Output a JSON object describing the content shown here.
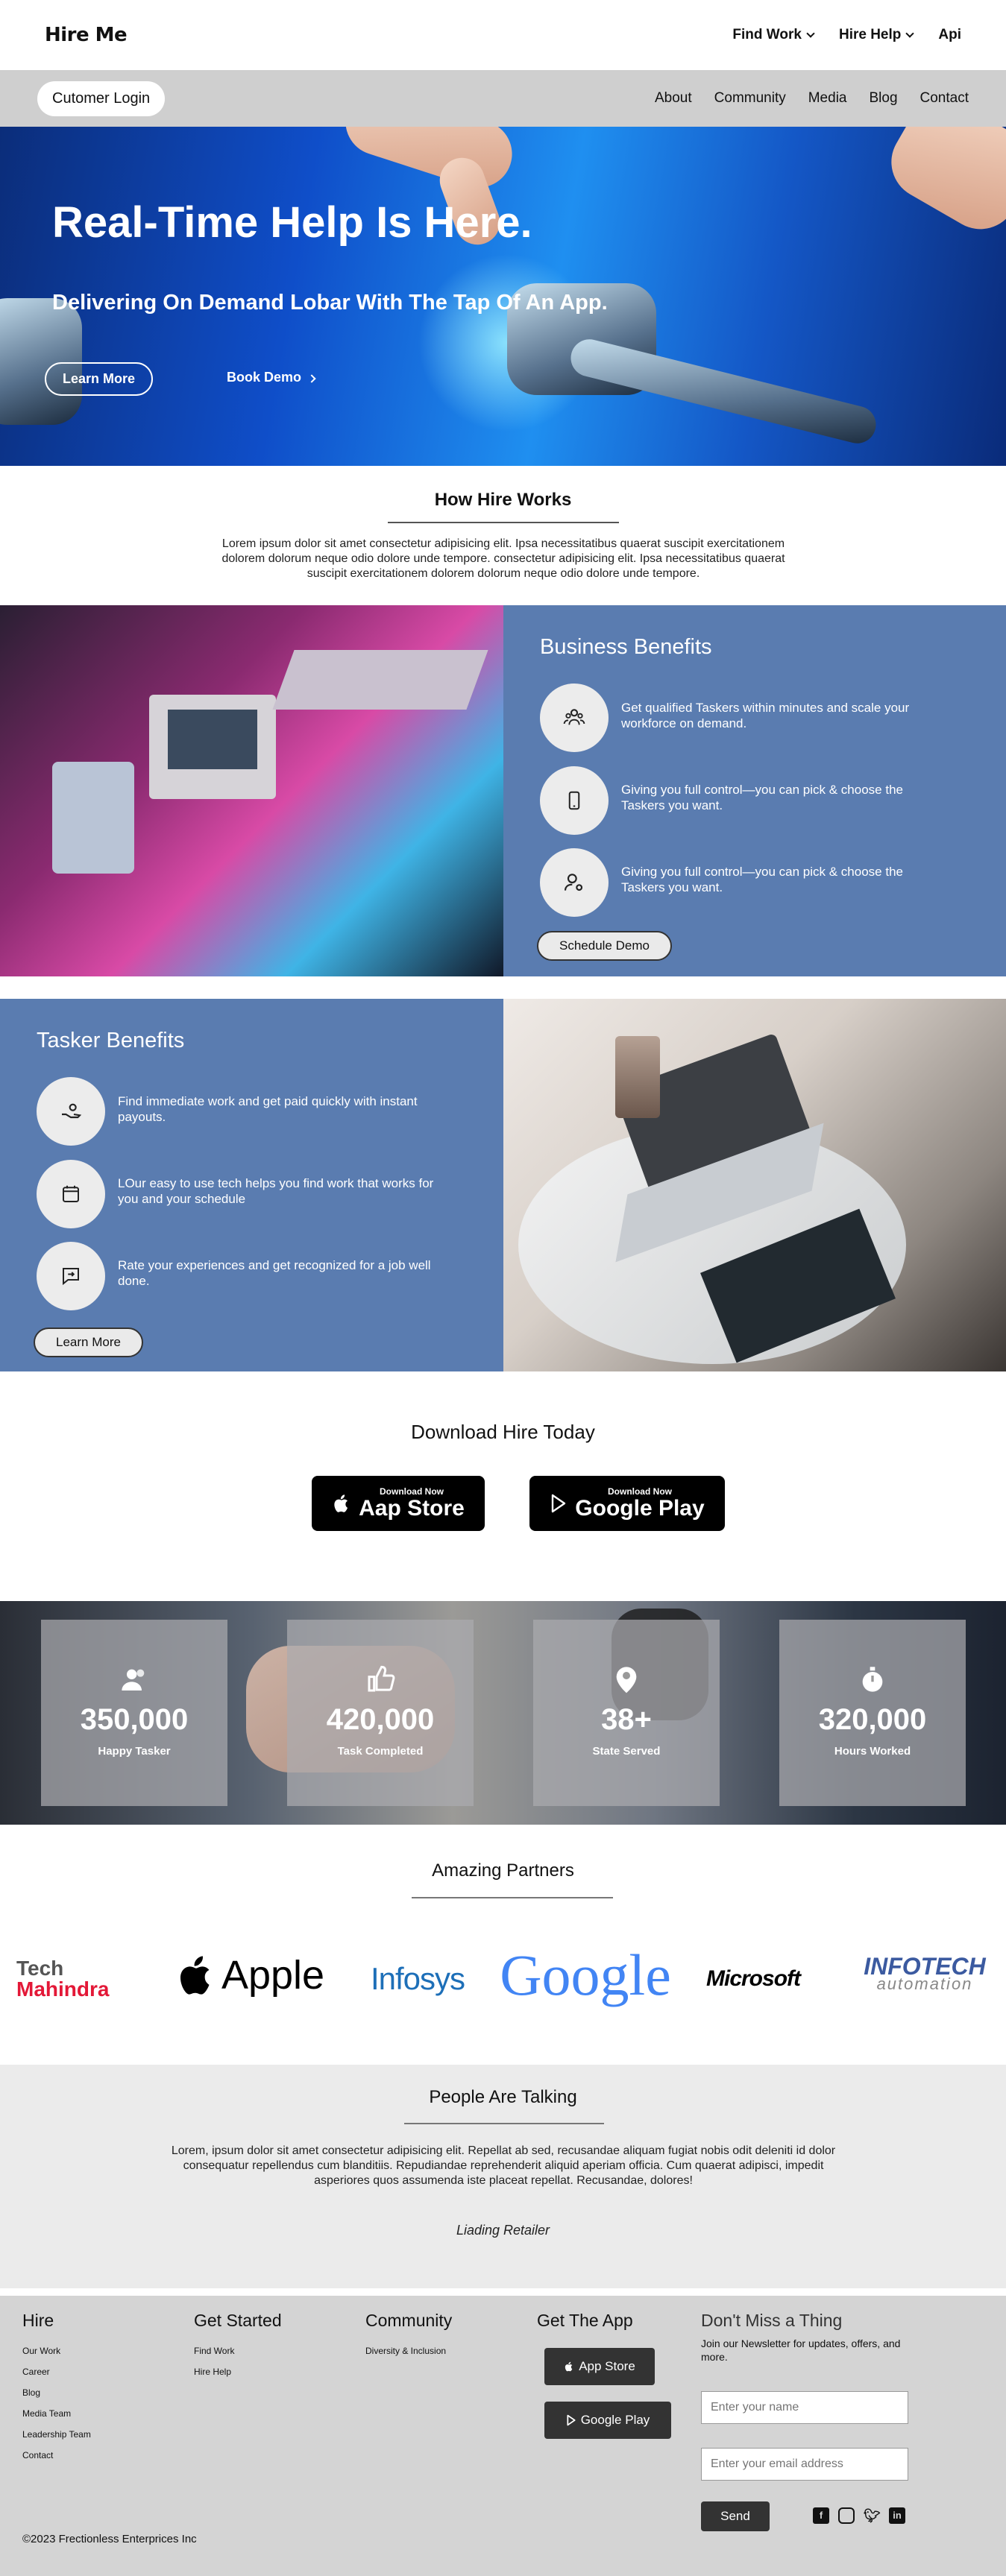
{
  "topnav": {
    "logo": "Hire Me",
    "find_work": "Find Work",
    "hire_help": "Hire Help",
    "api": "Api"
  },
  "subnav": {
    "login": "Cutomer Login",
    "links": [
      "About",
      "Community",
      "Media",
      "Blog",
      "Contact"
    ]
  },
  "hero": {
    "title": "Real-Time Help Is Here.",
    "subtitle": "Delivering On Demand Lobar With The Tap Of An App.",
    "learn_more": "Learn More",
    "book_demo": "Book Demo"
  },
  "how": {
    "title": "How Hire Works",
    "text": "Lorem ipsum dolor sit amet consectetur adipisicing elit. Ipsa necessitatibus quaerat suscipit exercitationem dolorem dolorum neque odio dolore unde tempore. consectetur adipisicing elit. Ipsa necessitatibus quaerat suscipit exercitationem dolorem dolorum neque odio dolore unde tempore."
  },
  "business": {
    "title": "Business Benefits",
    "items": [
      "Get qualified Taskers within minutes and scale your workforce on demand.",
      "Giving you full control—you can pick & choose the Taskers you want.",
      "Giving you full control—you can pick & choose the Taskers you want."
    ],
    "button": "Schedule Demo"
  },
  "tasker": {
    "title": "Tasker Benefits",
    "items": [
      "Find immediate work and get paid quickly with instant payouts.",
      "LOur easy to use tech helps you find work that works for you and your schedule",
      "Rate your experiences and get recognized for a job well done."
    ],
    "button": "Learn More"
  },
  "download": {
    "title": "Download Hire Today",
    "app_small": "Download Now",
    "app_big": "Aap Store",
    "play_small": "Download Now",
    "play_big": "Google Play"
  },
  "stats": [
    {
      "value": "350,000",
      "label": "Happy Tasker"
    },
    {
      "value": "420,000",
      "label": "Task Completed"
    },
    {
      "value": "38+",
      "label": "State Served"
    },
    {
      "value": "320,000",
      "label": "Hours Worked"
    }
  ],
  "partners": {
    "title": "Amazing Partners",
    "names": [
      "Tech",
      "Mahindra",
      "Apple",
      "Infosys",
      "Google",
      "Microsoft",
      "INFOTECH",
      "automation"
    ]
  },
  "talking": {
    "title": "People Are Talking",
    "text": "Lorem, ipsum dolor sit amet consectetur adipisicing elit. Repellat ab sed, recusandae aliquam fugiat nobis odit deleniti id dolor consequatur repellendus cum blanditiis. Repudiandae reprehenderit aliquid aperiam officia. Cum quaerat adipisci, impedit asperiores quos assumenda iste placeat repellat. Recusandae, dolores!",
    "author": "Liading Retailer"
  },
  "footer": {
    "hire": {
      "title": "Hire",
      "links": [
        "Our Work",
        "Career",
        "Blog",
        "Media Team",
        "Leadership Team",
        "Contact"
      ]
    },
    "started": {
      "title": "Get Started",
      "links": [
        "Find Work",
        "Hire Help"
      ]
    },
    "community": {
      "title": "Community",
      "links": [
        "Diversity & Inclusion"
      ]
    },
    "app": {
      "title": "Get The App",
      "app_store": "App Store",
      "google_play": "Google Play"
    },
    "news": {
      "title": "Don't Miss a Thing",
      "text": "Join our Newsletter for updates, offers, and more.",
      "name_ph": "Enter your name",
      "email_ph": "Enter your email address",
      "send": "Send"
    },
    "copyright": "©2023 Frectionless Enterprices Inc"
  },
  "colors": {
    "panel_blue": "#5a7cb0",
    "hero_blue": "#1f8ff0"
  }
}
